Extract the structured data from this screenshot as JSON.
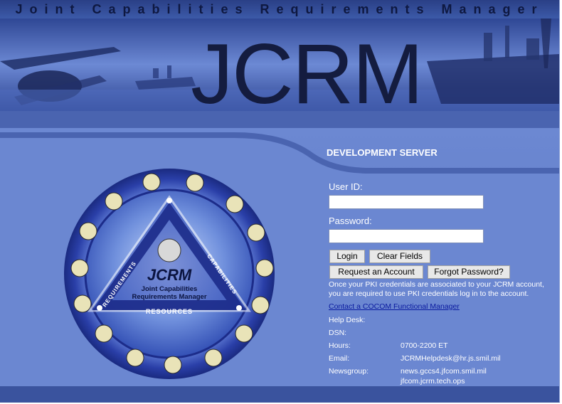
{
  "header": {
    "title": "Joint Capabilities Requirements Manager",
    "logo_text": "JCRM"
  },
  "server_notice": "DEVELOPMENT SERVER",
  "login": {
    "userid_label": "User ID:",
    "userid_value": "",
    "password_label": "Password:",
    "password_value": "",
    "login_button": "Login",
    "clear_button": "Clear Fields",
    "request_button": "Request an Account",
    "forgot_button": "Forgot Password?"
  },
  "pki_notice": [
    "Once your PKI credentials are associated to your JCRM account,",
    "you are required to use PKI credentials log in to the account."
  ],
  "contact_link": "Contact a COCOM Functional Manager",
  "support": {
    "help_desk_label": "Help Desk:",
    "dsn_label": "DSN:",
    "hours_label": "Hours:",
    "hours_value": "0700-2200 ET",
    "email_label": "Email:",
    "email_value": "JCRMHelpdesk@hr.js.smil.mil",
    "newsgroup_label": "Newsgroup:",
    "newsgroup_values": [
      "news.gccs4.jfcom.smil.mil",
      "jfcom.jcrm.tech.ops"
    ]
  },
  "seal": {
    "center_title": "JCRM",
    "center_sub1": "Joint Capabilities",
    "center_sub2": "Requirements Manager",
    "left_side": "REQUIREMENTS",
    "right_side": "CAPABILITIES",
    "bottom_side": "RESOURCES"
  },
  "icons": [
    "seal-emblem-icon"
  ]
}
